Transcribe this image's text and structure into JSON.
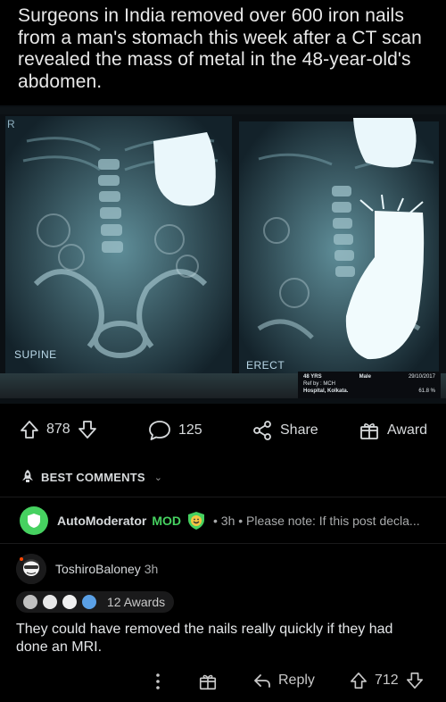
{
  "post": {
    "title": "Surgeons in India removed over 600 iron nails from a man's stomach this week after a CT scan revealed the mass of metal in the 48-year-old's abdomen."
  },
  "image": {
    "left_label": "SUPINE",
    "right_label": "ERECT",
    "corner_label": "R",
    "tag": {
      "age": "48 YRS",
      "sex": "Male",
      "date": "29/10/2017",
      "ref": "Ref by : MCH",
      "hospital": "Hospital, Kolkata.",
      "percent": "61.8 %"
    }
  },
  "actions": {
    "upvotes": "878",
    "comments": "125",
    "share_label": "Share",
    "award_label": "Award"
  },
  "comments_header": {
    "label": "BEST COMMENTS",
    "chevron": "⌄"
  },
  "automod": {
    "username": "AutoModerator",
    "mod_label": "MOD",
    "meta": "• 3h • Please note:  If this post decla..."
  },
  "comment": {
    "username": "ToshiroBaloney",
    "time": "3h",
    "awards_count": "12 Awards",
    "body": "They could have removed the nails really quickly if they had done an MRI.",
    "reply_label": "Reply",
    "score": "712"
  },
  "colors": {
    "background": "#000000",
    "mod_green": "#46d160",
    "text": "#d7dadc",
    "muted": "#a8aaab"
  }
}
